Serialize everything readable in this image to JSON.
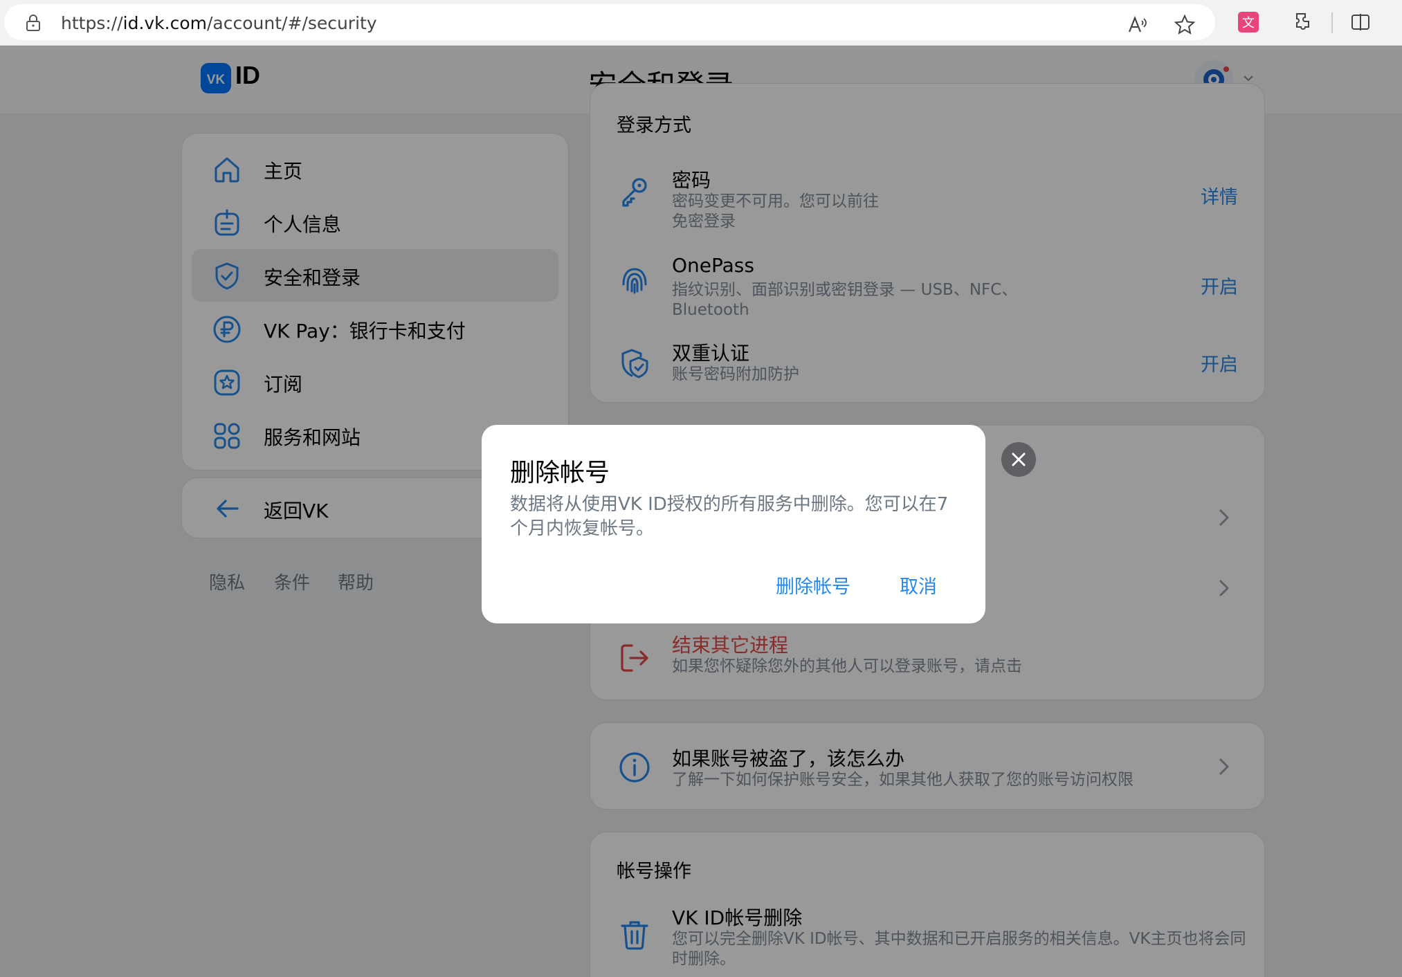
{
  "browser": {
    "url_prefix": "https://",
    "url_host": "id.vk.com",
    "url_path": "/account/#/security",
    "icons": [
      "lock-icon",
      "read-aloud-icon",
      "favorite-star-icon",
      "translate-icon",
      "extensions-icon",
      "split-screen-icon"
    ]
  },
  "header": {
    "logo_text": "ID",
    "title": "安全和登录"
  },
  "sidebar": {
    "items": [
      {
        "label": "主页",
        "icon": "home-icon"
      },
      {
        "label": "个人信息",
        "icon": "personal-info-icon"
      },
      {
        "label": "安全和登录",
        "icon": "shield-icon"
      },
      {
        "label": "VK Pay：银行卡和支付",
        "icon": "ruble-icon"
      },
      {
        "label": "订阅",
        "icon": "star-icon"
      },
      {
        "label": "服务和网站",
        "icon": "apps-icon"
      }
    ],
    "back_label": "返回VK",
    "footer": [
      "隐私",
      "条件",
      "帮助"
    ]
  },
  "login_methods": {
    "title": "登录方式",
    "rows": [
      {
        "title": "密码",
        "subtitle_1": "密码变更不可用。您可以前往",
        "subtitle_2": "免密登录",
        "action": "详情",
        "icon": "key-icon"
      },
      {
        "title": "OnePass",
        "subtitle_1": "指纹识别、面部识别或密钥登录 — USB、NFC、",
        "subtitle_2": "Bluetooth",
        "action": "开启",
        "icon": "fingerprint-icon"
      },
      {
        "title": "双重认证",
        "subtitle_1": "账号密码附加防护",
        "action": "开启",
        "icon": "two-factor-shield-icon"
      }
    ]
  },
  "sessions": {
    "end_title": "结束其它进程",
    "end_subtitle": "如果您怀疑除您外的其他人可以登录账号，请点击"
  },
  "stolen": {
    "title": "如果账号被盗了，该怎么办",
    "subtitle": "了解一下如何保护账号安全，如果其他人获取了您的账号访问权限"
  },
  "account_actions": {
    "title": "帐号操作",
    "row_title": "VK ID帐号删除",
    "row_subtitle_1": "您可以完全删除VK ID帐号、其中数据和已开启服务的相关信息。VK主页也将会同",
    "row_subtitle_2": "时删除。"
  },
  "modal": {
    "title": "删除帐号",
    "text": "数据将从使用VK ID授权的所有服务中删除。您可以在7个月内恢复帐号。",
    "confirm_label": "删除帐号",
    "cancel_label": "取消"
  },
  "colors": {
    "accent": "#2688eb",
    "danger": "#e64646",
    "vk_blue": "#0077ff",
    "muted_text": "#818c99"
  }
}
